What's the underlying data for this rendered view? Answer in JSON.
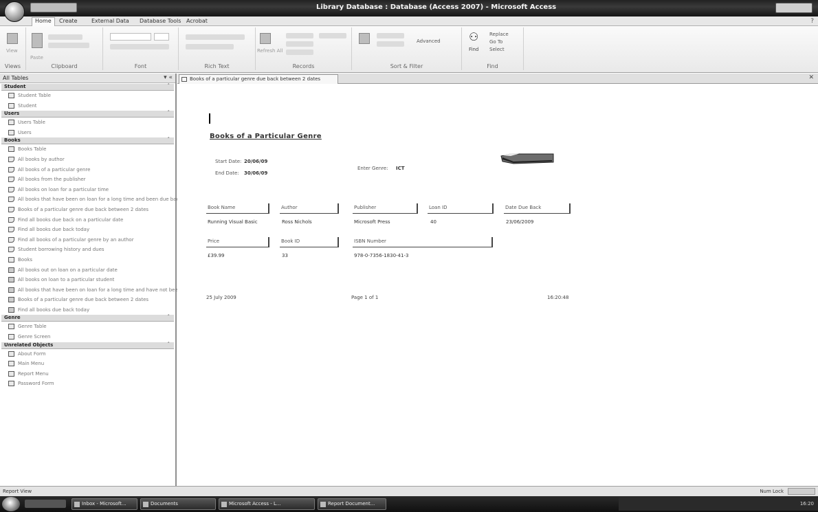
{
  "window": {
    "title": "Library Database : Database (Access 2007) - Microsoft Access"
  },
  "ribbon": {
    "tabs": [
      "Home",
      "Create",
      "External Data",
      "Database Tools",
      "Acrobat"
    ],
    "groups": [
      "Views",
      "Clipboard",
      "Font",
      "Rich Text",
      "Records",
      "Sort & Filter",
      "Find"
    ],
    "view_label": "View",
    "paste_label": "Paste",
    "refresh_label": "Refresh All",
    "find_label": "Find",
    "replace_label": "Replace",
    "goto_label": "Go To",
    "select_label": "Select",
    "advanced_label": "Advanced"
  },
  "nav": {
    "header": "All Tables",
    "groups": [
      {
        "label": "Student",
        "items": [
          {
            "label": "Student Table",
            "icon": "table-icon"
          },
          {
            "label": "Student",
            "icon": "form-icon"
          }
        ]
      },
      {
        "label": "Users",
        "items": [
          {
            "label": "Users Table",
            "icon": "table-icon"
          },
          {
            "label": "Users",
            "icon": "form-icon"
          }
        ]
      },
      {
        "label": "Books",
        "items": [
          {
            "label": "Books Table",
            "icon": "table-icon"
          },
          {
            "label": "All books by author",
            "icon": "query-icon"
          },
          {
            "label": "All books of a particular genre",
            "icon": "query-icon"
          },
          {
            "label": "All books from the publisher",
            "icon": "query-icon"
          },
          {
            "label": "All books on loan for a particular time",
            "icon": "query-icon"
          },
          {
            "label": "All books that have been on loan for a long time and been due back",
            "icon": "query-icon"
          },
          {
            "label": "Books of a particular genre due back between 2 dates",
            "icon": "query-icon"
          },
          {
            "label": "Find all books due back on a particular date",
            "icon": "query-icon"
          },
          {
            "label": "Find all books due back today",
            "icon": "query-icon"
          },
          {
            "label": "Find all books of a particular genre by an author",
            "icon": "query-icon"
          },
          {
            "label": "Student borrowing history and dues",
            "icon": "query-icon"
          },
          {
            "label": "Books",
            "icon": "form-icon"
          },
          {
            "label": "All books out on loan on a particular date",
            "icon": "report-icon"
          },
          {
            "label": "All books on loan to a particular student",
            "icon": "report-icon"
          },
          {
            "label": "All books that have been on loan for a long time and have not been returned",
            "icon": "report-icon"
          },
          {
            "label": "Books of a particular genre due back between 2 dates",
            "icon": "report-icon"
          },
          {
            "label": "Find all books due back today",
            "icon": "report-icon"
          }
        ]
      },
      {
        "label": "Genre",
        "items": [
          {
            "label": "Genre Table",
            "icon": "table-icon"
          },
          {
            "label": "Genre Screen",
            "icon": "form-icon"
          }
        ]
      },
      {
        "label": "Unrelated Objects",
        "items": [
          {
            "label": "About Form",
            "icon": "form-icon"
          },
          {
            "label": "Main Menu",
            "icon": "form-icon"
          },
          {
            "label": "Report Menu",
            "icon": "form-icon"
          },
          {
            "label": "Password Form",
            "icon": "macro-icon"
          }
        ]
      }
    ]
  },
  "document": {
    "tab_label": "Books of a particular genre due back between 2 dates",
    "report": {
      "title": "Books of a Particular Genre",
      "start_date_label": "Start Date:",
      "start_date": "20/06/09",
      "end_date_label": "End Date:",
      "end_date": "30/06/09",
      "genre_label": "Enter Genre:",
      "genre": "ICT",
      "columns_row1": [
        "Book Name",
        "Author",
        "Publisher",
        "Loan ID",
        "Date Due Back"
      ],
      "values_row1": [
        "Running Visual Basic",
        "Ross Nichols",
        "Microsoft Press",
        "40",
        "23/06/2009"
      ],
      "columns_row2": [
        "Price",
        "Book ID",
        "ISBN Number"
      ],
      "values_row2": [
        "£39.99",
        "33",
        "978-0-7356-1830-41-3"
      ],
      "footer_date": "25 July 2009",
      "footer_page": "Page 1 of 1",
      "footer_time": "16:20:48"
    }
  },
  "status": {
    "left": "Report View",
    "right": "Num Lock"
  },
  "taskbar": {
    "buttons": [
      "Inbox - Microsoft...",
      "Documents",
      "Microsoft Access - L...",
      "Report Document..."
    ],
    "tray_text": "16:20"
  }
}
